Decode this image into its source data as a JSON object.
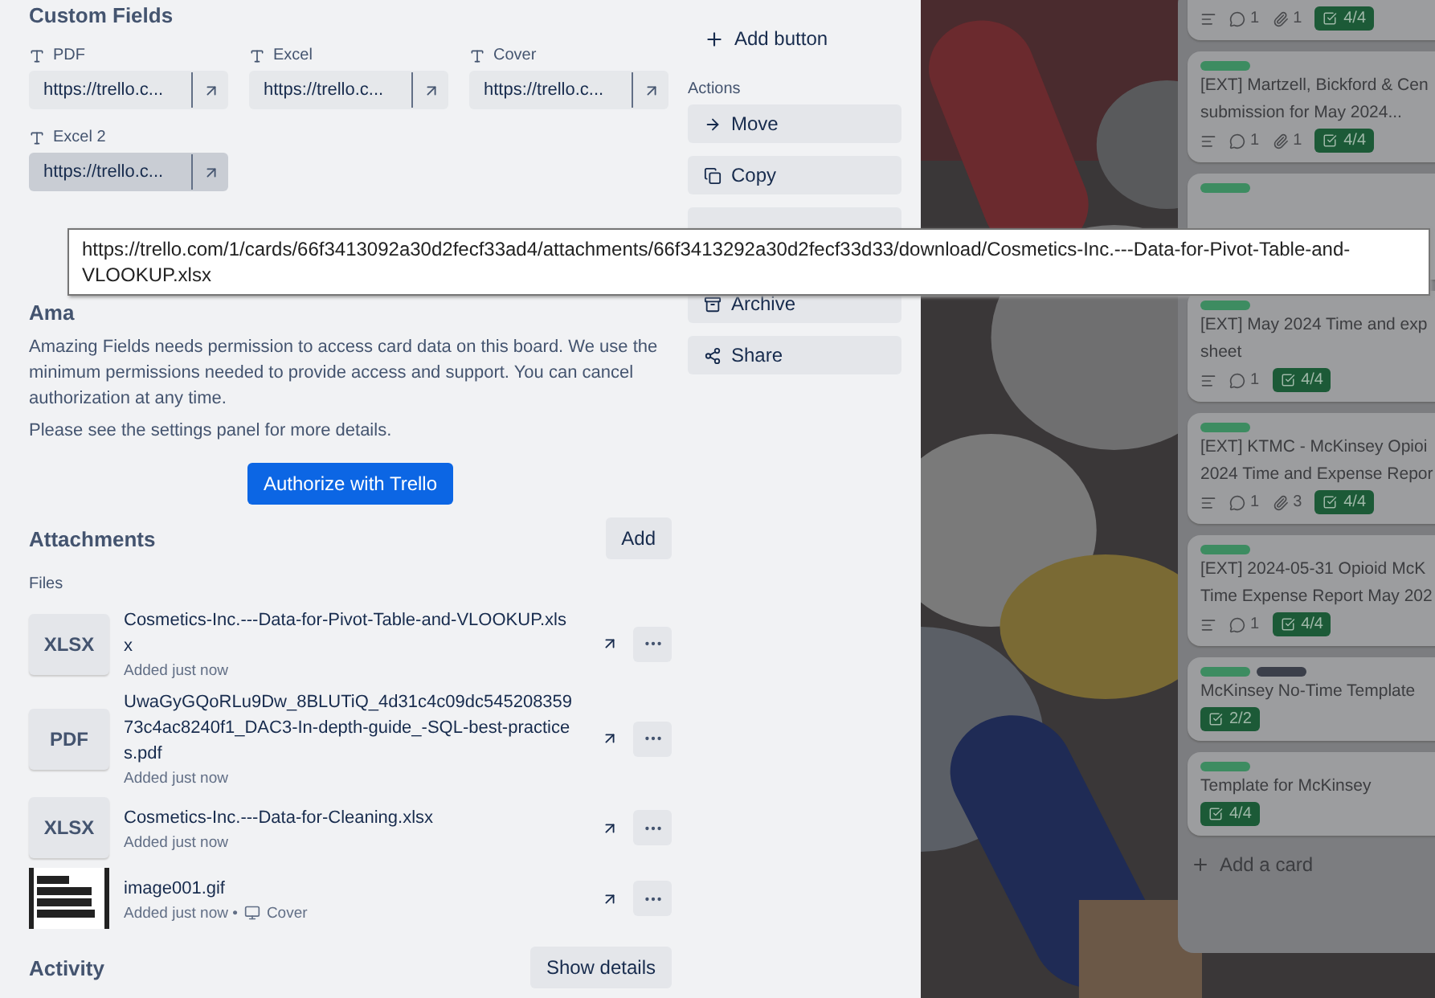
{
  "custom_fields": {
    "title": "Custom Fields",
    "fields": [
      {
        "name": "PDF",
        "value": "https://trello.c...",
        "hovered": false
      },
      {
        "name": "Excel",
        "value": "https://trello.c...",
        "hovered": false
      },
      {
        "name": "Cover",
        "value": "https://trello.c...",
        "hovered": false
      },
      {
        "name": "Excel 2",
        "value": "https://trello.c...",
        "hovered": true
      }
    ]
  },
  "power_up": {
    "title": "Ama",
    "description": "Amazing Fields needs permission to access card data on this board. We use the minimum permissions needed to provide access and support. You can cancel authorization at any time.",
    "note": "Please see the settings panel for more details.",
    "button": "Authorize with Trello"
  },
  "attachments": {
    "title": "Attachments",
    "add_button": "Add",
    "group_label": "Files",
    "files": [
      {
        "kind": "text",
        "thumb": "XLSX",
        "name": "Cosmetics-Inc.---Data-for-Pivot-Table-and-VLOOKUP.xlsx",
        "added": "Added just now"
      },
      {
        "kind": "text",
        "thumb": "PDF",
        "name": "UwaGyGQoRLu9Dw_8BLUTiQ_4d31c4c09dc545208359 73c4ac8240f1_DAC3-In-depth-guide_-SQL-best-practices.pdf",
        "added": "Added just now"
      },
      {
        "kind": "text",
        "thumb": "XLSX",
        "name": "Cosmetics-Inc.---Data-for-Cleaning.xlsx",
        "added": "Added just now"
      },
      {
        "kind": "picture",
        "name": "image001.gif",
        "added": "Added just now •",
        "cover": "Cover"
      }
    ]
  },
  "activity": {
    "title": "Activity",
    "button": "Show details"
  },
  "sidebar": {
    "add_button": "Add button",
    "actions_label": "Actions",
    "actions": [
      {
        "kind": "move",
        "label": "Move"
      },
      {
        "kind": "copy",
        "label": "Copy"
      },
      {
        "kind": "blank"
      },
      {
        "kind": "archive",
        "label": "Archive"
      },
      {
        "kind": "share",
        "label": "Share"
      }
    ]
  },
  "tooltip": {
    "lines": [
      "https://trello.com/1/cards/66f3413092a30d2fecf33ad4/attachments/66f3413292a30d2fecf33d33/download/Cosmetics-Inc.---Data-for-Pivot-Table-and-",
      "VLOOKUP.xlsx"
    ]
  },
  "list": {
    "cards": [
      {
        "badges": [
          {
            "kind": "description"
          },
          {
            "kind": "comments",
            "count": "1"
          },
          {
            "kind": "attachments",
            "count": "1"
          },
          {
            "kind": "checklist",
            "count": "4/4"
          }
        ]
      },
      {
        "labels": [
          {
            "color": "#3d8c61"
          }
        ],
        "title_lines": [
          "[EXT] Martzell, Bickford & Cen",
          "submission for May 2024..."
        ],
        "badges": [
          {
            "kind": "description"
          },
          {
            "kind": "comments",
            "count": "1"
          },
          {
            "kind": "attachments",
            "count": "1"
          },
          {
            "kind": "checklist",
            "count": "4/4"
          }
        ]
      },
      {
        "labels": [
          {
            "color": "#3d8c61"
          }
        ]
      },
      {
        "labels": [
          {
            "color": "#3d8c61"
          }
        ],
        "title_lines": [
          "[EXT] May 2024 Time and exp",
          "sheet"
        ],
        "badges": [
          {
            "kind": "description"
          },
          {
            "kind": "comments",
            "count": "1"
          },
          {
            "kind": "checklist",
            "count": "4/4"
          }
        ]
      },
      {
        "labels": [
          {
            "color": "#3d8c61"
          }
        ],
        "title_lines": [
          "[EXT] KTMC - McKinsey Opioi",
          "2024 Time and Expense Repor"
        ],
        "badges": [
          {
            "kind": "description"
          },
          {
            "kind": "comments",
            "count": "1"
          },
          {
            "kind": "attachments",
            "count": "3"
          },
          {
            "kind": "checklist",
            "count": "4/4"
          }
        ]
      },
      {
        "labels": [
          {
            "color": "#3d8c61"
          }
        ],
        "title_lines": [
          "[EXT] 2024-05-31 Opioid McK",
          "Time Expense Report May 202"
        ],
        "badges": [
          {
            "kind": "description"
          },
          {
            "kind": "comments",
            "count": "1"
          },
          {
            "kind": "checklist",
            "count": "4/4"
          }
        ]
      },
      {
        "labels": [
          {
            "color": "#3d8c61"
          },
          {
            "color": "#3b3f4a"
          }
        ],
        "title_lines": [
          "McKinsey No-Time Template"
        ],
        "badges": [
          {
            "kind": "checklist",
            "count": "2/2"
          }
        ]
      },
      {
        "labels": [
          {
            "color": "#3d8c61"
          }
        ],
        "title_lines": [
          "Template for McKinsey"
        ],
        "badges": [
          {
            "kind": "checklist",
            "count": "4/4"
          }
        ]
      }
    ],
    "add_card": "Add a card"
  }
}
